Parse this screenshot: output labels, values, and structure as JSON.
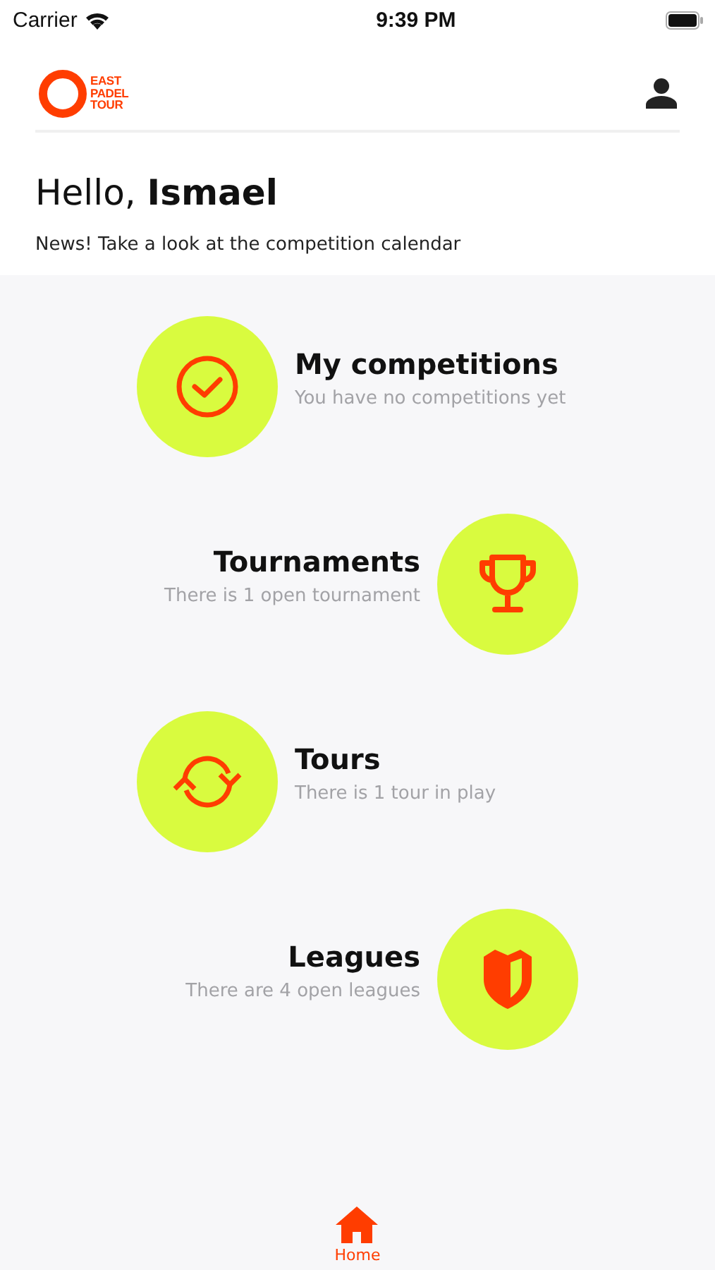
{
  "status_bar": {
    "carrier": "Carrier",
    "time": "9:39 PM"
  },
  "header": {
    "logo_lines": [
      "EAST",
      "PADEL",
      "TOUR"
    ]
  },
  "greeting": {
    "text": "Hello, **Ismael**",
    "news": "News! Take a look at the competition calendar"
  },
  "sections": [
    {
      "title": "My competitions",
      "subtitle": "You have no competitions yet"
    },
    {
      "title": "Tournaments",
      "subtitle": "There is 1 open tournament"
    },
    {
      "title": "Tours",
      "subtitle": "There is 1 tour in play"
    },
    {
      "title": "Leagues",
      "subtitle": "There are 4 open leagues"
    }
  ],
  "tab_bar": [
    {
      "label": "Home",
      "selected": true
    }
  ]
}
